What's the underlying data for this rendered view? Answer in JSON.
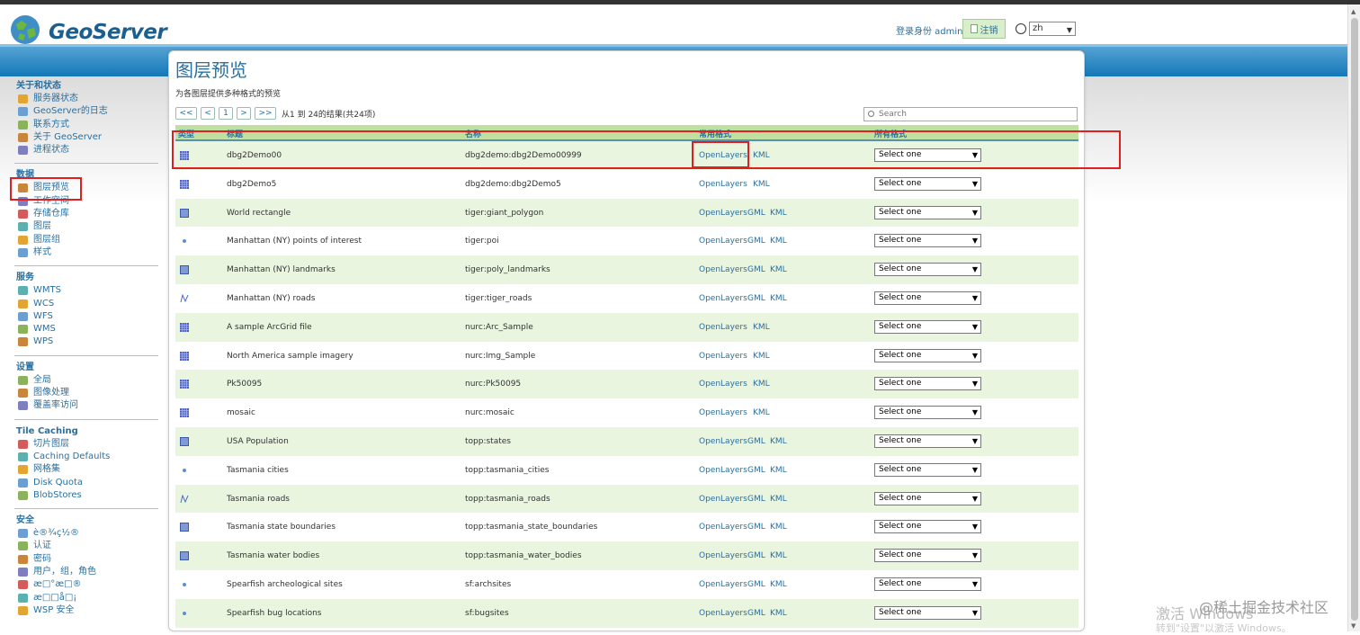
{
  "header": {
    "app_name": "GeoServer",
    "login_text": "登录身份 admin.",
    "logout_label": "注销",
    "language": "zh"
  },
  "sidebar": {
    "sections": [
      {
        "title": "关于和状态",
        "items": [
          "服务器状态",
          "GeoServer的日志",
          "联系方式",
          "关于 GeoServer",
          "进程状态"
        ]
      },
      {
        "title": "数据",
        "items": [
          "图层预览",
          "工作空间",
          "存储仓库",
          "图层",
          "图层组",
          "样式"
        ]
      },
      {
        "title": "服务",
        "items": [
          "WMTS",
          "WCS",
          "WFS",
          "WMS",
          "WPS"
        ]
      },
      {
        "title": "设置",
        "items": [
          "全局",
          "图像处理",
          "覆盖率访问"
        ]
      },
      {
        "title": "Tile Caching",
        "items": [
          "切片图层",
          "Caching Defaults",
          "网格集",
          "Disk Quota",
          "BlobStores"
        ]
      },
      {
        "title": "安全",
        "items": [
          "è®¾ç½®",
          "认证",
          "密码",
          "用户，组，角色",
          "æ□°æ□®",
          "æ□□å□¡",
          "WSP 安全"
        ]
      }
    ]
  },
  "main": {
    "title": "图层预览",
    "subtitle": "为各图层提供多种格式的预览",
    "pager": {
      "first": "<<",
      "prev": "<",
      "page": "1",
      "next": ">",
      "last": ">>",
      "info": "从1 到 24的结果(共24项)"
    },
    "search_placeholder": "Search",
    "columns": [
      "类型",
      "标题",
      "名称",
      "常用格式",
      "所有格式"
    ],
    "select_label": "Select one",
    "rows": [
      {
        "type": "raster",
        "title": "dbg2Demo00",
        "name": "dbg2demo:dbg2Demo00999",
        "formats": [
          "OpenLayers",
          "KML"
        ]
      },
      {
        "type": "raster",
        "title": "dbg2Demo5",
        "name": "dbg2demo:dbg2Demo5",
        "formats": [
          "OpenLayers",
          "KML"
        ]
      },
      {
        "type": "polygon",
        "title": "World rectangle",
        "name": "tiger:giant_polygon",
        "formats": [
          "OpenLayers",
          "GML",
          "KML"
        ]
      },
      {
        "type": "point",
        "title": "Manhattan (NY) points of interest",
        "name": "tiger:poi",
        "formats": [
          "OpenLayers",
          "GML",
          "KML"
        ]
      },
      {
        "type": "polygon",
        "title": "Manhattan (NY) landmarks",
        "name": "tiger:poly_landmarks",
        "formats": [
          "OpenLayers",
          "GML",
          "KML"
        ]
      },
      {
        "type": "line",
        "title": "Manhattan (NY) roads",
        "name": "tiger:tiger_roads",
        "formats": [
          "OpenLayers",
          "GML",
          "KML"
        ]
      },
      {
        "type": "raster",
        "title": "A sample ArcGrid file",
        "name": "nurc:Arc_Sample",
        "formats": [
          "OpenLayers",
          "KML"
        ]
      },
      {
        "type": "raster",
        "title": "North America sample imagery",
        "name": "nurc:Img_Sample",
        "formats": [
          "OpenLayers",
          "KML"
        ]
      },
      {
        "type": "raster",
        "title": "Pk50095",
        "name": "nurc:Pk50095",
        "formats": [
          "OpenLayers",
          "KML"
        ]
      },
      {
        "type": "raster",
        "title": "mosaic",
        "name": "nurc:mosaic",
        "formats": [
          "OpenLayers",
          "KML"
        ]
      },
      {
        "type": "polygon",
        "title": "USA Population",
        "name": "topp:states",
        "formats": [
          "OpenLayers",
          "GML",
          "KML"
        ]
      },
      {
        "type": "point",
        "title": "Tasmania cities",
        "name": "topp:tasmania_cities",
        "formats": [
          "OpenLayers",
          "GML",
          "KML"
        ]
      },
      {
        "type": "line",
        "title": "Tasmania roads",
        "name": "topp:tasmania_roads",
        "formats": [
          "OpenLayers",
          "GML",
          "KML"
        ]
      },
      {
        "type": "polygon",
        "title": "Tasmania state boundaries",
        "name": "topp:tasmania_state_boundaries",
        "formats": [
          "OpenLayers",
          "GML",
          "KML"
        ]
      },
      {
        "type": "polygon",
        "title": "Tasmania water bodies",
        "name": "topp:tasmania_water_bodies",
        "formats": [
          "OpenLayers",
          "GML",
          "KML"
        ]
      },
      {
        "type": "point",
        "title": "Spearfish archeological sites",
        "name": "sf:archsites",
        "formats": [
          "OpenLayers",
          "GML",
          "KML"
        ]
      },
      {
        "type": "point",
        "title": "Spearfish bug locations",
        "name": "sf:bugsites",
        "formats": [
          "OpenLayers",
          "GML",
          "KML"
        ]
      }
    ]
  },
  "watermark": {
    "left": "激活 Windows",
    "right": "@稀土掘金技术社区",
    "sub": "转到\"设置\"以激活 Windows。"
  },
  "colors": {
    "accent": "#2a6f9e",
    "row_alt": "#e9f5df",
    "header_bg": "#bfe0a1",
    "highlight": "#e02020"
  }
}
